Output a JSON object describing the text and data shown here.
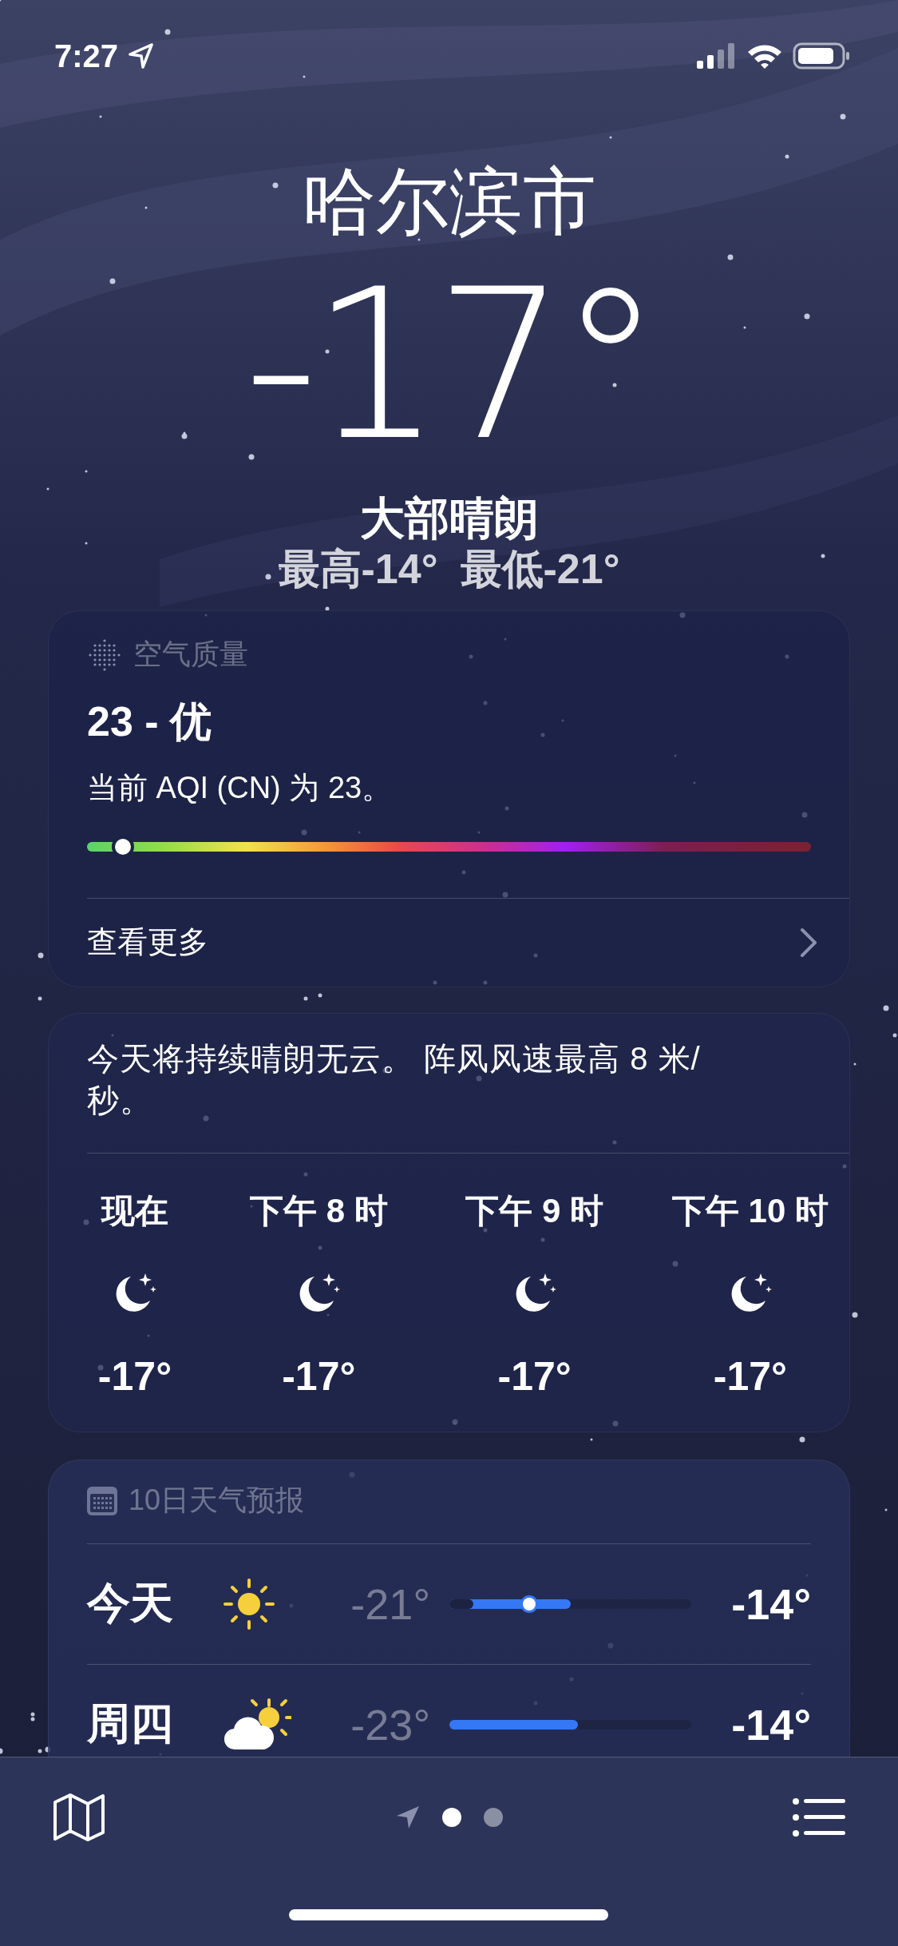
{
  "status_bar": {
    "time": "7:27"
  },
  "location": {
    "city": "哈尔滨市",
    "temperature": "-17°",
    "condition": "大部晴朗",
    "high": "最高-14°",
    "low": "最低-21°"
  },
  "air_quality": {
    "title": "空气质量",
    "value": "23 - 优",
    "description": "当前 AQI (CN) 为 23。",
    "meter": {
      "level": 0.05
    },
    "link": "查看更多"
  },
  "hourly": {
    "summary": "今天将持续晴朗无云。 阵风风速最高 8 米/秒。",
    "hours": [
      {
        "time": "现在",
        "kind": "moon",
        "temp": "-17°"
      },
      {
        "time": "下午 8 时",
        "kind": "moon",
        "temp": "-17°"
      },
      {
        "time": "下午 9 时",
        "kind": "moon",
        "temp": "-17°"
      },
      {
        "time": "下午 10 时",
        "kind": "moon",
        "temp": "-17°"
      }
    ]
  },
  "daily": {
    "title": "10日天气预报",
    "days": [
      {
        "day": "今天",
        "kind": "sun",
        "low": "-21°",
        "high": "-14°",
        "range_offset": {
          "level": 0.1
        },
        "range_end": {
          "level": 0.5
        },
        "current": {
          "level": 0.33
        }
      },
      {
        "day": "周四",
        "kind": "partly_cloudy",
        "low": "-23°",
        "high": "-14°",
        "range_end": {
          "level": 0.53
        }
      }
    ]
  },
  "toolbar": {
    "pages": [
      {
        "kind": "location",
        "selected": false
      },
      {
        "kind": "dot",
        "selected": true
      },
      {
        "kind": "dot",
        "selected": false
      }
    ]
  }
}
